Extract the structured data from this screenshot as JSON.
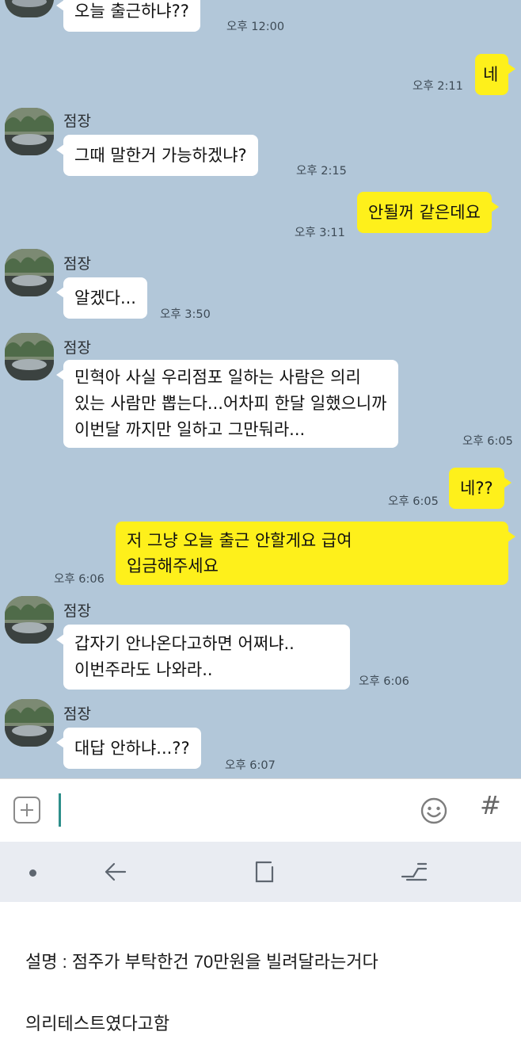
{
  "chat": {
    "sender_name": "점장",
    "messages": [
      {
        "dir": "in",
        "text": "오늘 출근하냐??",
        "time": "오후 12:00"
      },
      {
        "dir": "out",
        "text": "네",
        "time": "오후 2:11"
      },
      {
        "dir": "in",
        "text": "그때 말한거 가능하겠냐?",
        "time": "오후 2:15"
      },
      {
        "dir": "out",
        "text": "안될꺼 같은데요",
        "time": "오후 3:11"
      },
      {
        "dir": "in",
        "text": "알겠다...",
        "time": "오후 3:50"
      },
      {
        "dir": "in",
        "lines": [
          "민혁아 사실 우리점포 일하는 사람은 의리",
          "있는 사람만 뽑는다...어차피 한달 일했으니까",
          "이번달 까지만 일하고 그만둬라..."
        ],
        "time": "오후 6:05"
      },
      {
        "dir": "out",
        "text": "네??",
        "time": "오후 6:05"
      },
      {
        "dir": "out",
        "lines": [
          "저 그냥 오늘 출근 안할게요 급여",
          "입금해주세요"
        ],
        "time": "오후 6:06"
      },
      {
        "dir": "in",
        "lines": [
          "갑자기 안나온다고하면 어쩌냐..",
          "이번주라도 나와라.."
        ],
        "time": "오후 6:06"
      },
      {
        "dir": "in",
        "text": "대답 안하냐...??",
        "time": "오후 6:07"
      }
    ]
  },
  "input_bar": {
    "icons": [
      "plus-icon",
      "emoji-icon",
      "hash-icon"
    ],
    "hash_glyph": "#"
  },
  "nav_bar": {
    "icons": [
      "dot-icon",
      "back-icon",
      "recent-apps-icon",
      "switch-icon"
    ]
  },
  "caption": {
    "line1": "설명 : 점주가 부탁한건 70만원을 빌려달라는거다",
    "line2": "의리테스트였다고함"
  }
}
